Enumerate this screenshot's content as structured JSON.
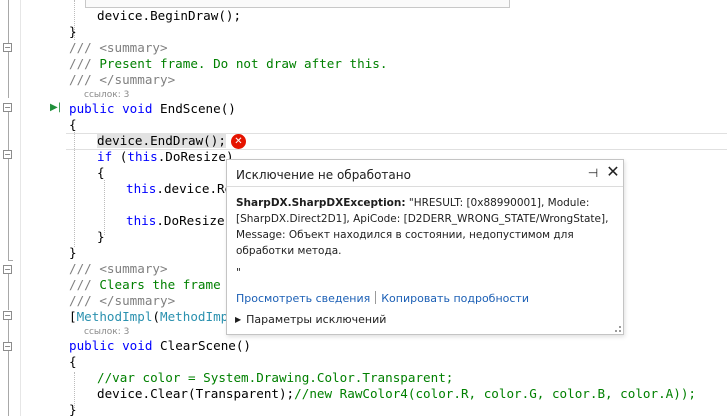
{
  "code": {
    "begin_draw_obj": "device",
    "begin_draw_call": ".BeginDraw();",
    "brace_close": "}",
    "brace_open": "{",
    "doc_prefix": "///",
    "summary_open": "<summary>",
    "summary_close": "</summary>",
    "endscene_doc": "Present frame. Do not draw after this.",
    "refs_label": "ссылок: 3",
    "kw_public": "public",
    "kw_void": "void",
    "endscene_sig": "EndScene()",
    "end_draw_stmt": "device.EndDraw();",
    "kw_if": "if",
    "kw_this": "this",
    "if_rest": ".DoResize)",
    "paren_open": "(",
    "resize_line1_a": "device",
    "resize_line1_b": ".Re",
    "resize_line2": ".DoResize",
    "clears_doc": "Clears the frame",
    "attr_open": "[",
    "attr_type": "MethodImpl",
    "attr_type2": "MethodImpl",
    "clearscene_sig": "ClearScene()",
    "var_color_comment": "//var color = System.Drawing.Color.Transparent;",
    "clear_obj": "device",
    "clear_call": ".Clear(Transparent);",
    "clear_comment": "//new RawColor4(color.R, color.G, color.B, color.A));",
    "dot": "."
  },
  "exception_popup": {
    "title": "Исключение не обработано",
    "exception_type": "SharpDX.SharpDXException:",
    "message": "\"HRESULT: [0x88990001], Module: [SharpDX.Direct2D1], ApiCode: [D2DERR_WRONG_STATE/WrongState], Message: Объект находился в состоянии, недопустимом для обработки метода.",
    "extra": "\"",
    "link_details": "Просмотреть сведения",
    "link_copy": "Копировать подробности",
    "exception_settings": "Параметры исключений",
    "pin_glyph": "⊣",
    "close_glyph": "✕"
  },
  "icons": {
    "debug_arrow": "▶|",
    "error_glyph": "✕",
    "outline_minus": "−"
  },
  "colors": {
    "keyword": "#0000ff",
    "comment": "#008000",
    "doc_comment": "#808080",
    "type": "#2b91af",
    "error": "#e51400",
    "link": "#1b5fb5"
  }
}
